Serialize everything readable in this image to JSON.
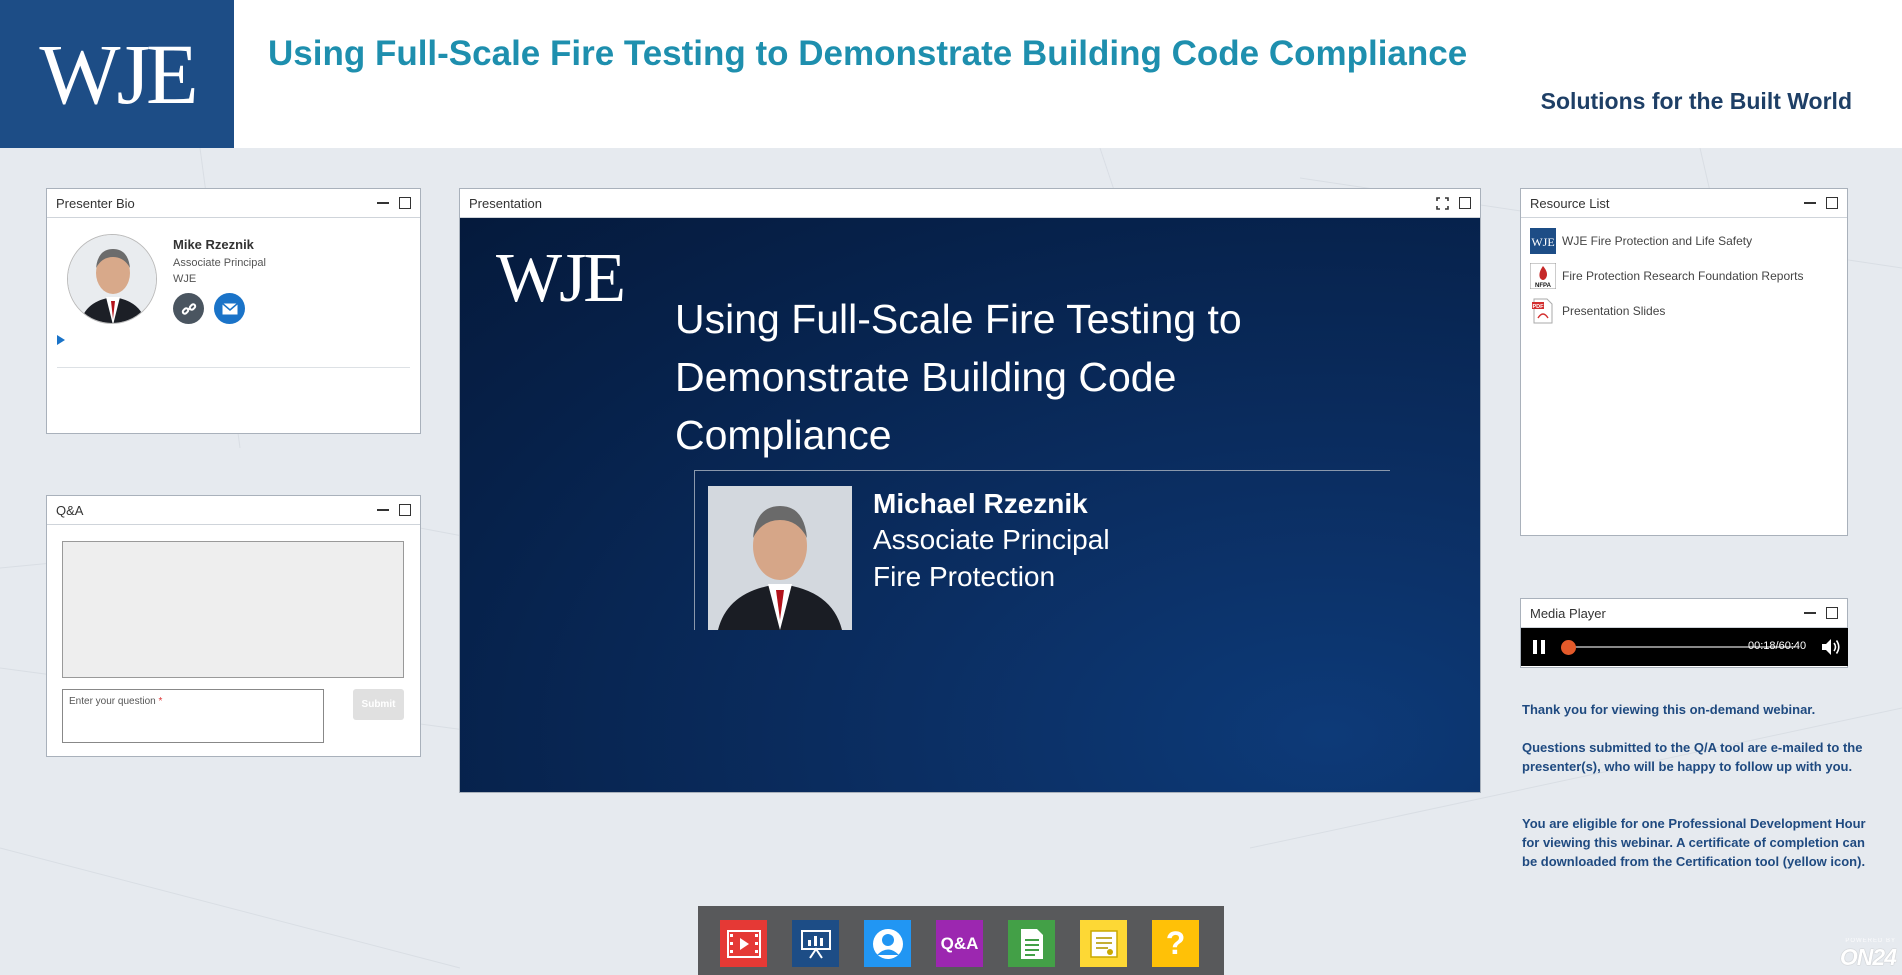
{
  "header": {
    "logo": "WJE",
    "title": "Using Full-Scale Fire Testing to Demonstrate Building Code Compliance",
    "tagline": "Solutions for the Built World",
    "brand_color": "#1d4d86",
    "title_color": "#1e8fae"
  },
  "presenter_bio": {
    "title": "Presenter Bio",
    "name": "Mike Rzeznik",
    "role": "Associate Principal",
    "org": "WJE",
    "icons": [
      "link-icon",
      "mail-icon"
    ]
  },
  "qa": {
    "title": "Q&A",
    "input_placeholder": "Enter your question",
    "required_marker": "*",
    "submit_label": "Submit"
  },
  "presentation": {
    "title": "Presentation",
    "slide": {
      "logo": "WJE",
      "title": "Using Full-Scale Fire Testing to Demonstrate Building Code Compliance",
      "presenter_name": "Michael Rzeznik",
      "presenter_role": "Associate Principal",
      "presenter_dept": "Fire Protection"
    }
  },
  "resources": {
    "title": "Resource List",
    "items": [
      {
        "label": "WJE Fire Protection and Life Safety",
        "icon": "wje-logo-icon"
      },
      {
        "label": "Fire Protection Research Foundation Reports",
        "icon": "nfpa-icon"
      },
      {
        "label": "Presentation Slides",
        "icon": "pdf-icon"
      }
    ]
  },
  "media_player": {
    "title": "Media Player",
    "time": "00:18/60:40",
    "progress": 0.005,
    "state": "playing",
    "accent": "#e45a2a"
  },
  "info": {
    "p1": "Thank you for viewing this on-demand webinar.",
    "p2": "Questions submitted to the Q/A tool are e-mailed to the presenter(s), who will be happy to follow up with you.",
    "p3": "You are eligible for one Professional Development Hour for viewing this webinar. A certificate of completion can be downloaded from the Certification tool (yellow icon)."
  },
  "dock": {
    "items": [
      {
        "name": "media-player-icon",
        "color": "#e53935"
      },
      {
        "name": "presentation-icon",
        "color": "#1d4d86"
      },
      {
        "name": "presenter-bio-icon",
        "color": "#2196f3"
      },
      {
        "name": "qa-icon",
        "label": "Q&A",
        "color": "#9c27b0"
      },
      {
        "name": "resource-list-icon",
        "color": "#43a047"
      },
      {
        "name": "certificate-icon",
        "color": "#fdd835"
      },
      {
        "name": "help-icon",
        "label": "?",
        "color": "#ffc107"
      }
    ]
  },
  "powered_by": {
    "small": "POWERED BY",
    "brand": "ON24"
  }
}
